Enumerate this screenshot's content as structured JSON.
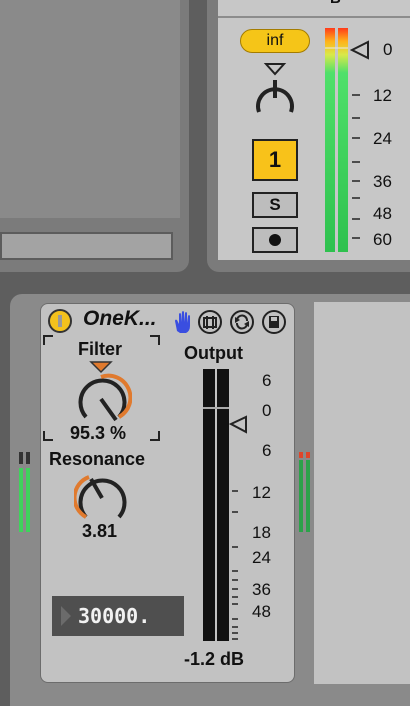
{
  "track": {
    "label": "B",
    "inf_button": "inf",
    "track_number": "1",
    "solo": "S",
    "meter_scale": [
      "0",
      "12",
      "24",
      "36",
      "48",
      "60"
    ]
  },
  "device": {
    "title": "OneK...",
    "filter": {
      "label": "Filter",
      "value": "95.3 %"
    },
    "resonance": {
      "label": "Resonance",
      "value": "3.81"
    },
    "frequency": "30000.",
    "output": {
      "label": "Output",
      "value": "-1.2 dB",
      "scale": [
        "6",
        "0",
        "6",
        "12",
        "18",
        "24",
        "36",
        "48"
      ]
    }
  },
  "colors": {
    "accent_yellow": "#f5c518",
    "knob_orange": "#e07a2e",
    "meter_green": "#39d353"
  },
  "icons": [
    "hand-icon",
    "resize-icon",
    "refresh-icon",
    "save-icon",
    "power-icon",
    "record-icon"
  ]
}
